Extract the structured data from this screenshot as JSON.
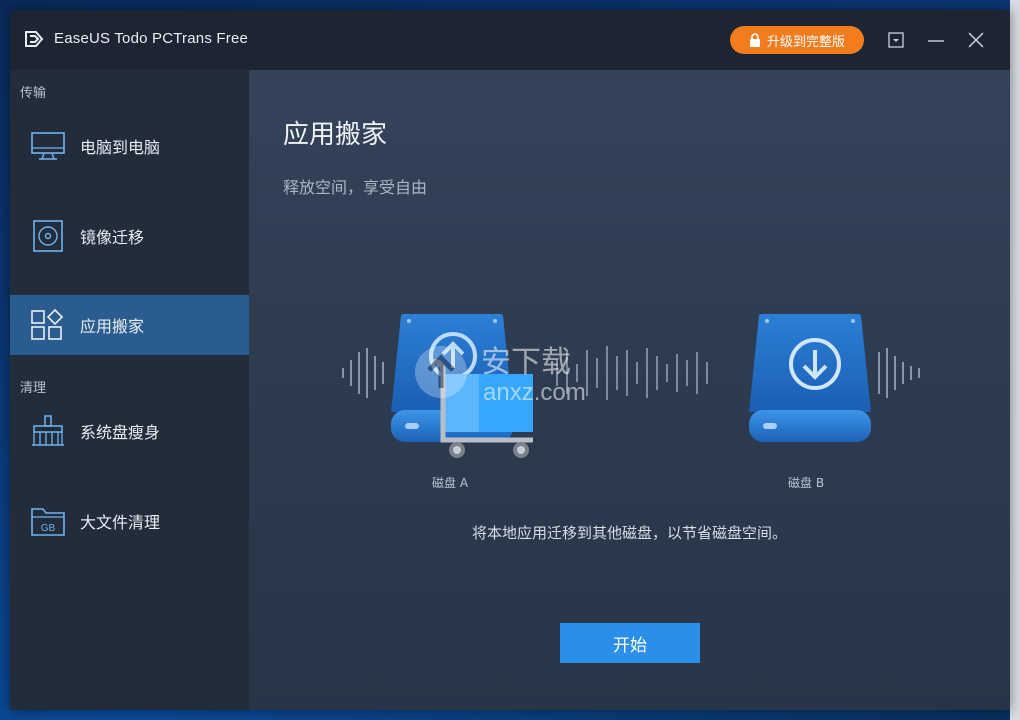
{
  "window": {
    "title": "EaseUS Todo PCTrans Free",
    "upgrade_label": "升级到完整版"
  },
  "sidebar": {
    "sections": [
      {
        "label": "传输"
      },
      {
        "label": "清理"
      }
    ],
    "items": [
      {
        "label": "电脑到电脑",
        "icon": "monitor-icon"
      },
      {
        "label": "镜像迁移",
        "icon": "disc-icon"
      },
      {
        "label": "应用搬家",
        "icon": "apps-icon",
        "active": true
      },
      {
        "label": "系统盘瘦身",
        "icon": "broom-icon"
      },
      {
        "label": "大文件清理",
        "icon": "gb-folder-icon"
      }
    ]
  },
  "main": {
    "title": "应用搬家",
    "subtitle": "释放空间，享受自由",
    "disk_a_label": "磁盘 A",
    "disk_b_label": "磁盘 B",
    "description": "将本地应用迁移到其他磁盘，以节省磁盘空间。",
    "start_label": "开始"
  },
  "watermark": {
    "text_cn": "安下载",
    "text_en": "anxz.com"
  },
  "colors": {
    "accent": "#2b8ee8",
    "upgrade": "#f27c1e",
    "active_nav": "#2b5c8f"
  }
}
